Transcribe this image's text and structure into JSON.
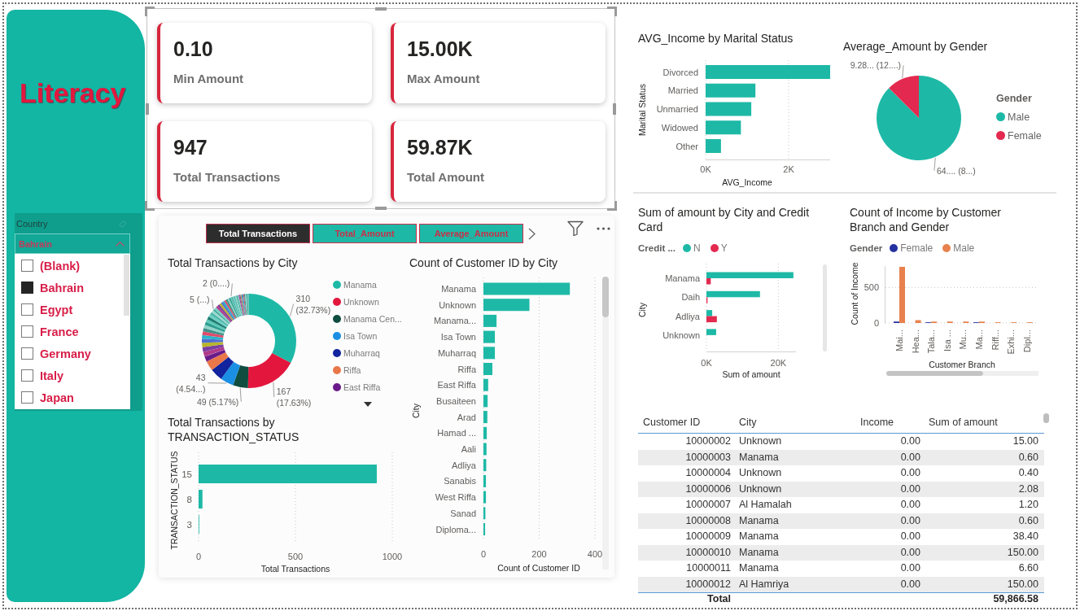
{
  "sidebar": {
    "title": "Literacy",
    "slicer": {
      "label": "Country",
      "value": "Bahrain",
      "expanded": true,
      "items": [
        {
          "label": "(Blank)",
          "checked": false
        },
        {
          "label": "Bahrain",
          "checked": true
        },
        {
          "label": "Egypt",
          "checked": false
        },
        {
          "label": "France",
          "checked": false
        },
        {
          "label": "Germany",
          "checked": false
        },
        {
          "label": "Italy",
          "checked": false
        },
        {
          "label": "Japan",
          "checked": false
        }
      ]
    }
  },
  "kpi_cards": [
    {
      "value": "0.10",
      "label": "Min Amount"
    },
    {
      "value": "15.00K",
      "label": "Max Amount"
    },
    {
      "value": "947",
      "label": "Total Transactions"
    },
    {
      "value": "59.87K",
      "label": "Total Amount"
    }
  ],
  "report_panel": {
    "bookmark_buttons": [
      {
        "label": "Total Transactions",
        "selected": true
      },
      {
        "label": "Total_Amount",
        "selected": false
      },
      {
        "label": "Average_Amount",
        "selected": false
      }
    ],
    "transactions_by_city": {
      "slices": [
        {
          "color": "#1db9a6"
        },
        {
          "color": "#e3173e"
        },
        {
          "color": "#0f4d40"
        },
        {
          "color": "#1a8fe3"
        },
        {
          "color": "#12239e"
        },
        {
          "color": "#e9774a"
        },
        {
          "color": "#6a1b8a"
        }
      ],
      "chart_data": {
        "type": "donut",
        "title": "Total Transactions by City",
        "categories": [
          "Manama",
          "Unknown",
          "Manama Cen...",
          "Isa Town",
          "Muharraq",
          "Riffa",
          "East Riffa",
          null
        ],
        "values": [
          32.73,
          17.63,
          5.17,
          4.54,
          4.33,
          3.38,
          1.8,
          30.42
        ],
        "legend": "right",
        "annotations": [
          {
            "text": "310 (32.73%)"
          },
          {
            "text": "167 (17.63%)"
          },
          {
            "text": "49 (5.17%)"
          },
          {
            "text": "43 (4.54...)"
          },
          {
            "text": "5 (...)"
          },
          {
            "text": "2 (0....)"
          }
        ]
      }
    },
    "transactions_by_status": {
      "chart_data": {
        "type": "bar",
        "orientation": "horizontal",
        "title": "Total Transactions by TRANSACTION_STATUS",
        "categories": [
          "15",
          "8",
          "3"
        ],
        "values": [
          920,
          20,
          3
        ],
        "xlim": [
          0,
          1000
        ],
        "xticks": [
          0,
          500,
          1000
        ],
        "xlabel": "Total Transactions",
        "ylabel": "TRANSACTION_STATUS"
      }
    },
    "customers_by_city": {
      "chart_data": {
        "type": "bar",
        "orientation": "horizontal",
        "title": "Count of Customer ID by City",
        "categories": [
          "Manama",
          "Unknown",
          "Manama...",
          "Isa Town",
          "Muharraq",
          "Riffa",
          "East Riffa",
          "Busaiteen",
          "Arad",
          "Hamad ...",
          "Aali",
          "Adliya",
          "Sanabis",
          "West Riffa",
          "Sanad",
          "Diploma..."
        ],
        "values": [
          310,
          165,
          47,
          41,
          41,
          32,
          17,
          15,
          14,
          12,
          11,
          10,
          9,
          9,
          7,
          6
        ],
        "xlim": [
          0,
          400
        ],
        "xticks": [
          0,
          200,
          400
        ],
        "xlabel": "Count of Customer ID",
        "ylabel": "City"
      }
    }
  },
  "income_by_marital_status": {
    "chart_data": {
      "type": "bar",
      "orientation": "horizontal",
      "title": "AVG_Income by Marital Status",
      "categories": [
        "Divorced",
        "Married",
        "Unmarried",
        "Widowed",
        "Other"
      ],
      "values": [
        3000,
        1200,
        1100,
        850,
        370
      ],
      "xlim": [
        0,
        3000
      ],
      "xticks": [
        {
          "value": 0,
          "label": "0K"
        },
        {
          "value": 2000,
          "label": "2K"
        }
      ],
      "xlabel": "AVG_Income",
      "ylabel": "Marital Status"
    }
  },
  "amount_by_gender": {
    "legend_title": "Gender",
    "slices": [
      {
        "color": "#1db9a6"
      },
      {
        "color": "#e3294f"
      }
    ],
    "chart_data": {
      "type": "pie",
      "title": "Average_Amount by Gender",
      "categories": [
        "Male",
        "Female"
      ],
      "values": [
        87.5,
        12.5
      ],
      "legend": "right",
      "annotations": [
        {
          "text": "64.... (8...)"
        },
        {
          "text": "9.28... (12....)"
        }
      ]
    }
  },
  "amount_by_city_and_credit_card": {
    "legend_title": "Credit ...",
    "chart_data": {
      "type": "bar",
      "orientation": "horizontal",
      "title": "Sum of amount by City and Credit Card",
      "categories": [
        "Manama",
        "Daih",
        "Adliya",
        "Unknown"
      ],
      "series": [
        {
          "name": "N",
          "color": "#1db9a6",
          "values": [
            24200,
            14900,
            1600,
            2700
          ]
        },
        {
          "name": "Y",
          "color": "#e3294f",
          "values": [
            1200,
            300,
            2900,
            0
          ]
        }
      ],
      "legend": "top",
      "xlim": [
        0,
        25000
      ],
      "xticks": [
        {
          "value": 0,
          "label": "0K"
        },
        {
          "value": 20000,
          "label": "20K"
        }
      ],
      "xlabel": "Sum of amount",
      "ylabel": "City"
    }
  },
  "income_count_by_branch_and_gender": {
    "legend_title": "Gender",
    "chart_data": {
      "type": "bar",
      "orientation": "vertical",
      "title": "Count of Income by Customer Branch and Gender",
      "categories": [
        "Mai...",
        "Hea...",
        "Tala...",
        "Isa ...",
        "Mu...",
        "Ma...",
        "Riff...",
        "Exhi...",
        "Dipl..."
      ],
      "series": [
        {
          "name": "Female",
          "color": "#2330a0",
          "values": [
            20,
            0,
            10,
            0,
            0,
            10,
            0,
            0,
            0
          ]
        },
        {
          "name": "Male",
          "color": "#e8814d",
          "values": [
            790,
            40,
            20,
            20,
            20,
            20,
            10,
            10,
            10
          ]
        }
      ],
      "legend": "top",
      "ylim": [
        0,
        800
      ],
      "yticks": [
        0,
        500
      ],
      "xlabel": "Customer Branch",
      "ylabel": "Count of Income"
    }
  },
  "customer_table": {
    "columns": [
      "Customer ID",
      "City",
      "Income",
      "Sum of amount"
    ],
    "rows": [
      [
        "10000002",
        "Unknown",
        "0.00",
        "15.00"
      ],
      [
        "10000003",
        "Manama",
        "0.00",
        "0.60"
      ],
      [
        "10000004",
        "Unknown",
        "0.00",
        "0.40"
      ],
      [
        "10000006",
        "Unknown",
        "0.00",
        "2.08"
      ],
      [
        "10000007",
        "Al Hamalah",
        "0.00",
        "1.20"
      ],
      [
        "10000008",
        "Manama",
        "0.00",
        "0.60"
      ],
      [
        "10000009",
        "Manama",
        "0.00",
        "38.40"
      ],
      [
        "10000010",
        "Manama",
        "0.00",
        "150.00"
      ],
      [
        "10000011",
        "Manama",
        "0.00",
        "6.60"
      ],
      [
        "10000012",
        "Al Hamriya",
        "0.00",
        "150.00"
      ]
    ],
    "total": {
      "label": "Total",
      "sum_of_amount": "59,866.58"
    }
  }
}
